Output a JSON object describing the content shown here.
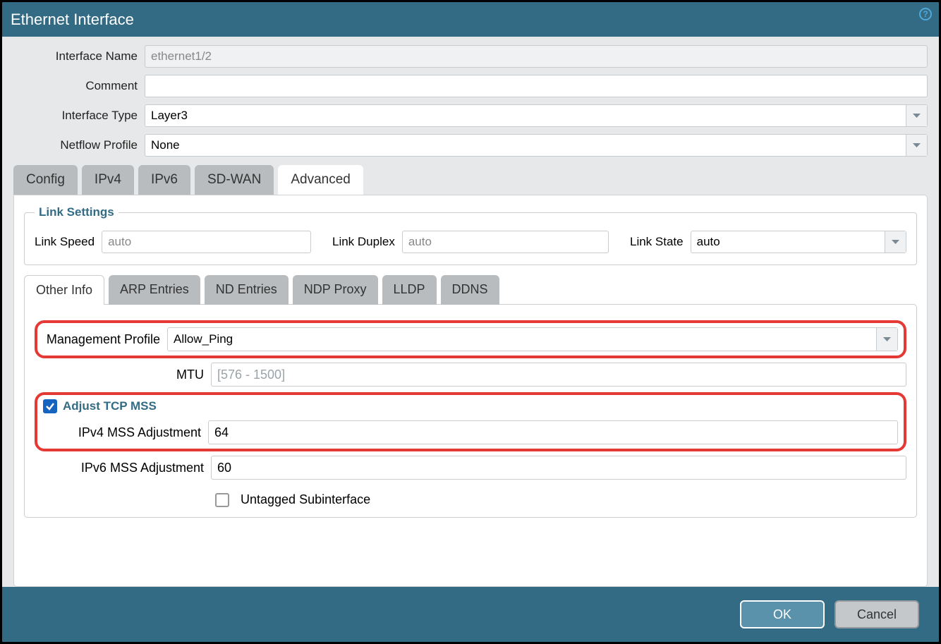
{
  "dialog": {
    "title": "Ethernet Interface"
  },
  "form": {
    "interface_name_label": "Interface Name",
    "interface_name_value": "ethernet1/2",
    "comment_label": "Comment",
    "comment_value": "",
    "interface_type_label": "Interface Type",
    "interface_type_value": "Layer3",
    "netflow_profile_label": "Netflow Profile",
    "netflow_profile_value": "None"
  },
  "tabs": {
    "items": [
      "Config",
      "IPv4",
      "IPv6",
      "SD-WAN",
      "Advanced"
    ],
    "active": "Advanced"
  },
  "link_settings": {
    "legend": "Link Settings",
    "speed_label": "Link Speed",
    "speed_value": "auto",
    "duplex_label": "Link Duplex",
    "duplex_value": "auto",
    "state_label": "Link State",
    "state_value": "auto"
  },
  "subtabs": {
    "items": [
      "Other Info",
      "ARP Entries",
      "ND Entries",
      "NDP Proxy",
      "LLDP",
      "DDNS"
    ],
    "active": "Other Info"
  },
  "other_info": {
    "mgmt_profile_label": "Management Profile",
    "mgmt_profile_value": "Allow_Ping",
    "mtu_label": "MTU",
    "mtu_placeholder": "[576 - 1500]",
    "mtu_value": "",
    "adjust_mss_label": "Adjust TCP MSS",
    "adjust_mss_checked": true,
    "ipv4_mss_label": "IPv4 MSS Adjustment",
    "ipv4_mss_value": "64",
    "ipv6_mss_label": "IPv6 MSS Adjustment",
    "ipv6_mss_value": "60",
    "untagged_label": "Untagged Subinterface",
    "untagged_checked": false
  },
  "footer": {
    "ok": "OK",
    "cancel": "Cancel"
  }
}
